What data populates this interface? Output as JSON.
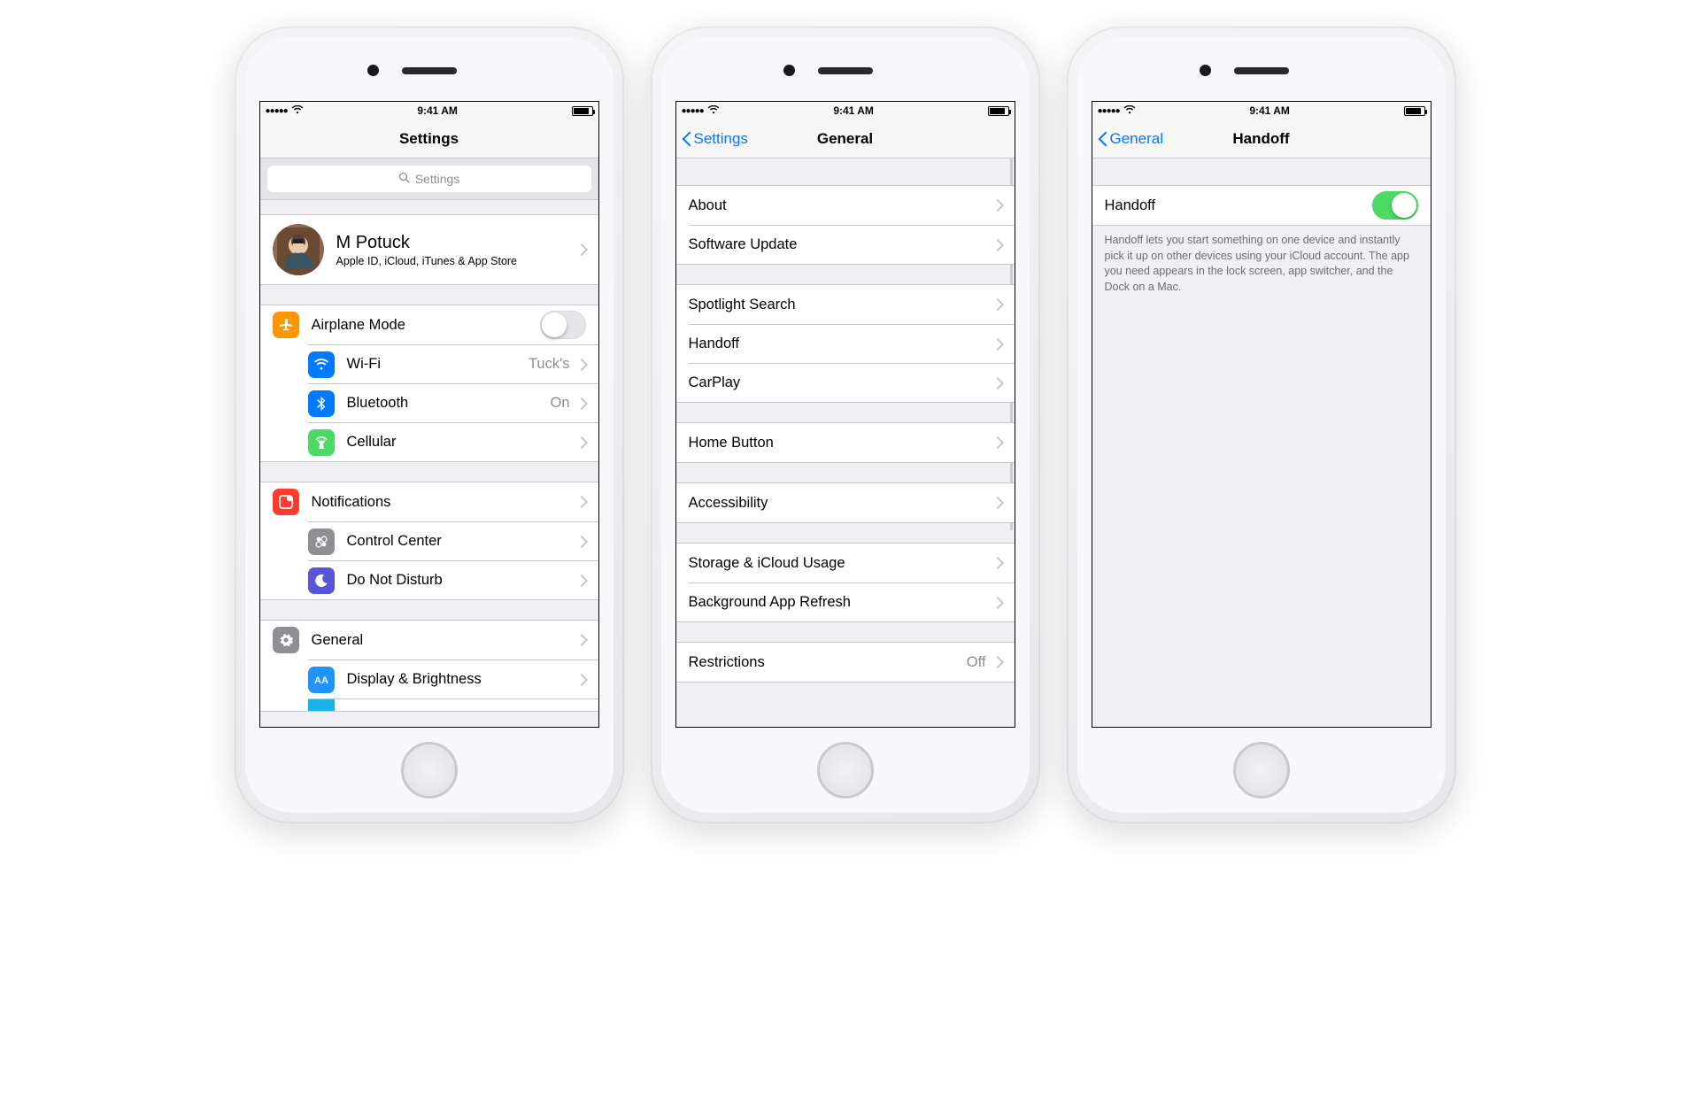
{
  "status": {
    "time": "9:41 AM"
  },
  "screen1": {
    "title": "Settings",
    "search_placeholder": "Settings",
    "profile": {
      "name": "M Potuck",
      "subtitle": "Apple ID, iCloud, iTunes & App Store"
    },
    "groupA": {
      "airplane": {
        "label": "Airplane Mode"
      },
      "wifi": {
        "label": "Wi-Fi",
        "value": "Tuck's"
      },
      "bluetooth": {
        "label": "Bluetooth",
        "value": "On"
      },
      "cellular": {
        "label": "Cellular"
      }
    },
    "groupB": {
      "notifications": {
        "label": "Notifications"
      },
      "control_center": {
        "label": "Control Center"
      },
      "dnd": {
        "label": "Do Not Disturb"
      }
    },
    "groupC": {
      "general": {
        "label": "General"
      },
      "display": {
        "label": "Display & Brightness"
      }
    }
  },
  "screen2": {
    "back": "Settings",
    "title": "General",
    "g1": {
      "about": "About",
      "software_update": "Software Update"
    },
    "g2": {
      "spotlight": "Spotlight Search",
      "handoff": "Handoff",
      "carplay": "CarPlay"
    },
    "g3": {
      "home_button": "Home Button"
    },
    "g4": {
      "accessibility": "Accessibility"
    },
    "g5": {
      "storage": "Storage & iCloud Usage",
      "bg_refresh": "Background App Refresh"
    },
    "g6": {
      "restrictions": {
        "label": "Restrictions",
        "value": "Off"
      }
    }
  },
  "screen3": {
    "back": "General",
    "title": "Handoff",
    "row_label": "Handoff",
    "description": "Handoff lets you start something on one device and instantly pick it up on other devices using your iCloud account. The app you need appears in the lock screen, app switcher, and the Dock on a Mac."
  }
}
